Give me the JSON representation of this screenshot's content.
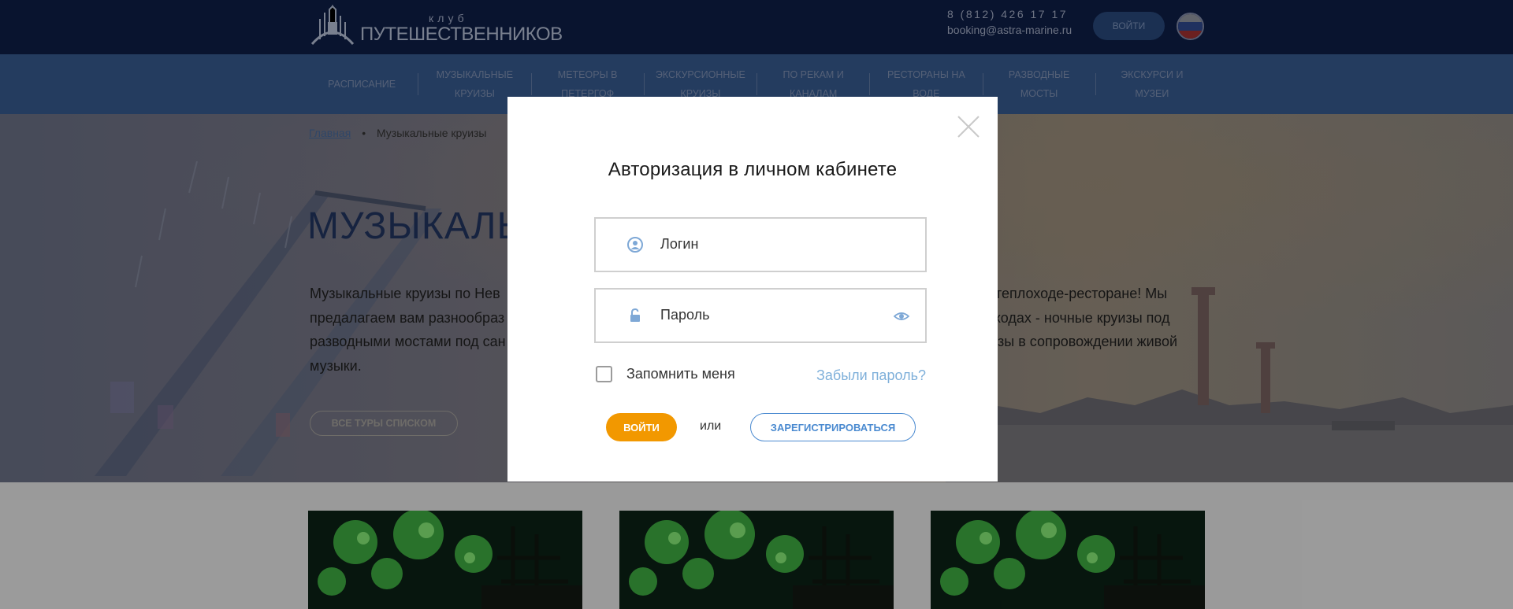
{
  "header": {
    "logo_club": "клуб",
    "logo_name": "ПУТЕШЕСТВЕННИКОВ",
    "phone": "8 (812) 426 17 17",
    "email": "booking@astra-marine.ru",
    "login_label": "войти",
    "language_icon": "russia-flag-icon"
  },
  "menu": {
    "items": [
      {
        "label": "РАСПИСАНИЕ"
      },
      {
        "label": "МУЗЫКАЛЬНЫЕ КРУИЗЫ"
      },
      {
        "label": "МЕТЕОРЫ В ПЕТЕРГОФ"
      },
      {
        "label": "ЭКСКУРСИОННЫЕ КРУИЗЫ"
      },
      {
        "label": "ПО РЕКАМ И КАНАЛАМ"
      },
      {
        "label": "РЕСТОРАНЫ НА ВОДЕ"
      },
      {
        "label": "РАЗВОДНЫЕ МОСТЫ"
      },
      {
        "label": "ЭКСКУРСИ И МУЗЕИ"
      }
    ]
  },
  "breadcrumb": {
    "home": "Главная",
    "current": "Музыкальные круизы"
  },
  "hero": {
    "title": "МУЗЫКАЛЬ",
    "line1_left": "Музыкальные круизы по Нев",
    "line1_right": "е на теплоходе-ресторане! Мы",
    "line2_left": "предалагаем вам разнообраз",
    "line2_right": "ходах - ночные круизы под",
    "line3_left": "разводными мостами под сан",
    "line3_right": "изы в сопровождении живой",
    "line4": "музыки.",
    "all_tours_label": "ВСЕ ТУРЫ СПИСКОМ"
  },
  "modal": {
    "title": "Авторизация в личном кабинете",
    "login_placeholder": "Логин",
    "password_placeholder": "Пароль",
    "remember_label": "Запомнить меня",
    "remember_checked": false,
    "forgot_label": "Забыли пароль?",
    "login_button": "ВОЙТИ",
    "or_label": "или",
    "register_button": "ЗАРЕГИСТРИРОВАТЬСЯ"
  },
  "colors": {
    "header_bg": "#0c1a3d",
    "menu_bg": "#2f4e7a",
    "accent_orange": "#f29800",
    "link_blue": "#4a8ad0",
    "forgot_blue": "#7fb0da"
  }
}
